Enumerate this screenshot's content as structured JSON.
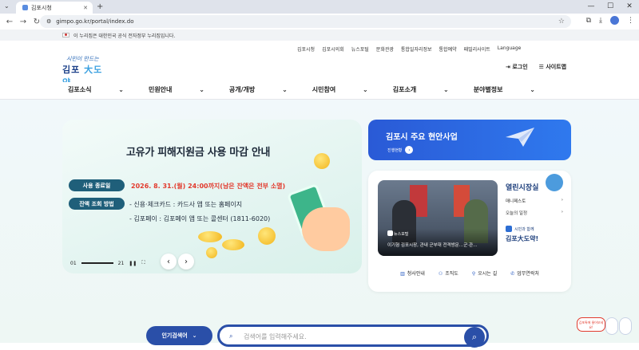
{
  "browser": {
    "tab_title": "김포시청",
    "url": "gimpo.go.kr/portal/index.do"
  },
  "gov_notice": "이 누리집은 대한민국 공식 전자정부 누리집입니다.",
  "logo": {
    "line1": "시민이 만드는",
    "line2a": "김포",
    "line2b": "大도약"
  },
  "top_links": [
    "김포시청",
    "김포시의회",
    "뉴스포털",
    "문화관광",
    "통합일자리정보",
    "통합예약",
    "패밀리사이트",
    "Language"
  ],
  "util": {
    "login": "로그인",
    "sitemap": "사이트맵"
  },
  "menu": [
    "김포소식",
    "민원안내",
    "공개/개방",
    "시민참여",
    "김포소개",
    "분야별정보"
  ],
  "banner": {
    "title": "고유가 피해지원금 사용 마감 안내",
    "pill1": "사용 종료일",
    "date_text": "2026. 8. 31.(월) 24:00까지(남은 잔액은 전부 소멸)",
    "pill2": "잔액 조회 방법",
    "line1": "- 신용·체크카드 : 카드사 앱 또는 홈페이지",
    "line2": "- 김포페이 : 김포페이 앱 또는 콜센터 (1811-6020)",
    "page_current": "01",
    "page_total": "21"
  },
  "issue": {
    "title": "김포시 주요 현안사업",
    "sub": "진행현황"
  },
  "news": {
    "badge": "뉴스포털",
    "caption": "이기형 김포시장, 관내 군부대 전격방문…군·관…"
  },
  "mayor": {
    "title": "열린시장실",
    "items": [
      "매니페스토",
      "오늘의 일정"
    ],
    "with": "시민과 함께",
    "slogan": "김포大도약!"
  },
  "quick_links": [
    "청사안내",
    "조직도",
    "오시는 길",
    "업무연락처"
  ],
  "search": {
    "keyword_label": "인기검색어",
    "placeholder": "검색어를 입력해주세요."
  },
  "chat": {
    "label": "김포톡에 물어보세요!"
  }
}
